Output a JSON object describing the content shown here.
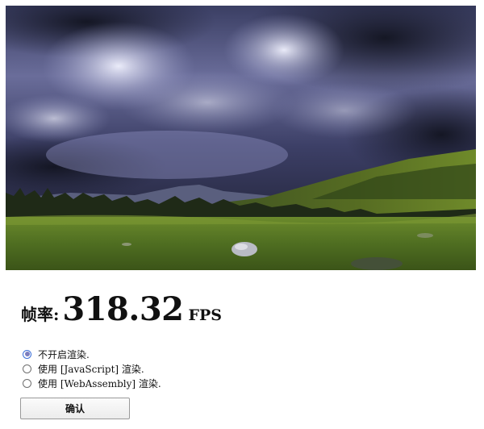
{
  "fps": {
    "label": "帧率:",
    "value": "318.32",
    "unit": "FPS"
  },
  "render_options": [
    {
      "label": "不开启渲染.",
      "checked": true
    },
    {
      "label": "使用 [JavaScript] 渲染.",
      "checked": false
    },
    {
      "label": "使用 [WebAssembly] 渲染.",
      "checked": false
    }
  ],
  "confirm_label": "确认",
  "colors": {
    "radio_checked": "#7b7dbe",
    "button_border": "#9a9a9a",
    "sky_dark": "#1c1f33",
    "grass": "#4f6e21"
  }
}
